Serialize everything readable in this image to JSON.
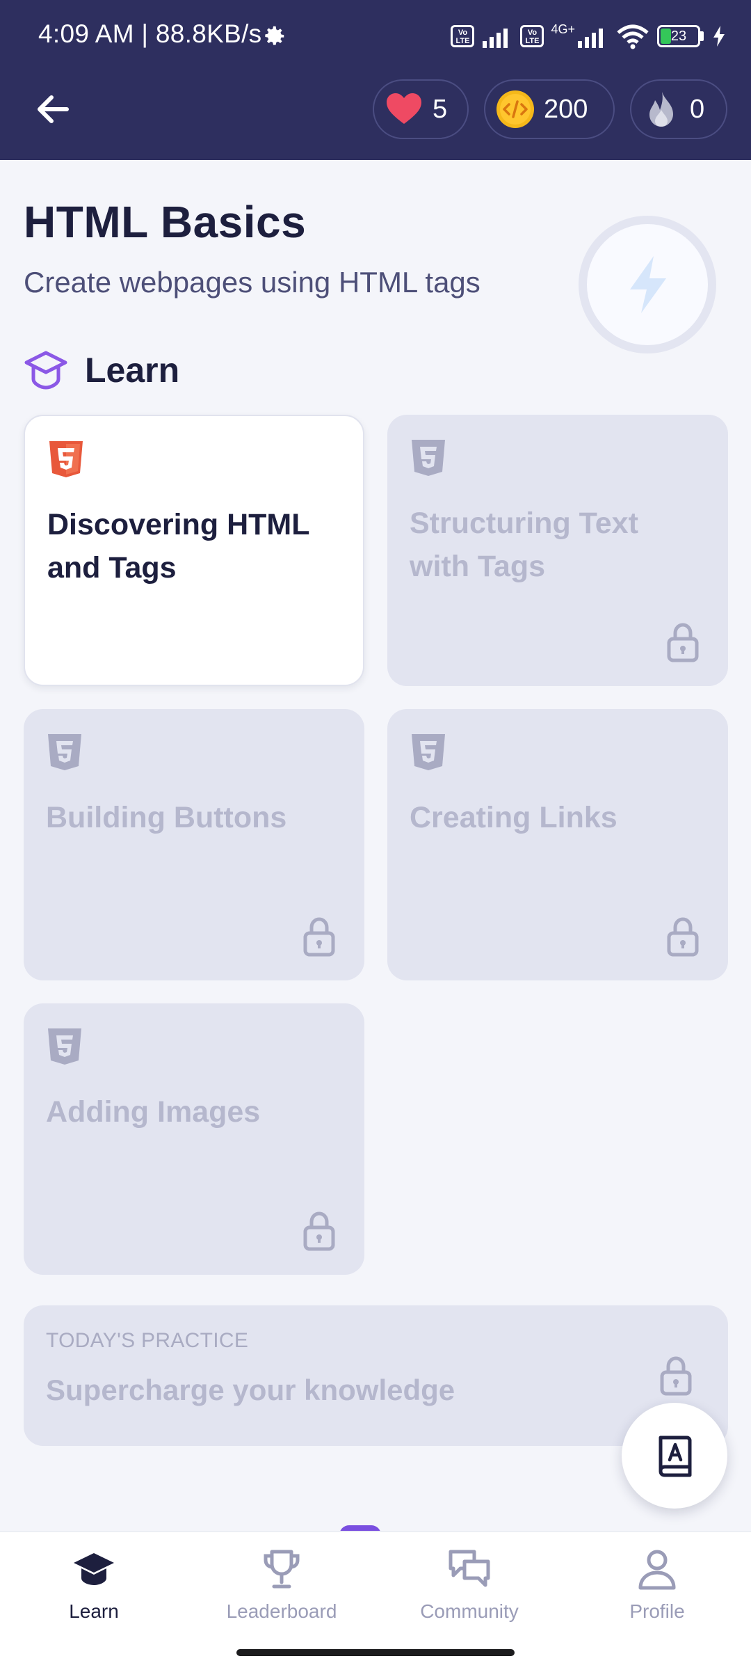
{
  "status_bar": {
    "time": "4:09 AM | 88.8KB/s",
    "volte_1": "Vo LTE",
    "volte_2": "Vo LTE",
    "network_type": "4G+",
    "battery": "23"
  },
  "stats": {
    "hearts": "5",
    "coins": "200",
    "streak": "0"
  },
  "course": {
    "title": "HTML Basics",
    "subtitle": "Create webpages using HTML tags"
  },
  "section": {
    "label": "Learn"
  },
  "lessons": [
    {
      "title": "Discovering HTML and Tags",
      "locked": false,
      "icon": "html5-icon"
    },
    {
      "title": "Structuring Text with Tags",
      "locked": true,
      "icon": "html5-icon"
    },
    {
      "title": "Building Buttons",
      "locked": true,
      "icon": "html5-icon"
    },
    {
      "title": "Creating Links",
      "locked": true,
      "icon": "html5-icon"
    },
    {
      "title": "Adding Images",
      "locked": true,
      "icon": "html5-icon"
    }
  ],
  "practice": {
    "kicker": "TODAY'S PRACTICE",
    "title": "Supercharge your knowledge",
    "locked": true
  },
  "nav": {
    "items": [
      {
        "label": "Learn",
        "icon": "graduation-cap-icon",
        "active": true
      },
      {
        "label": "Leaderboard",
        "icon": "trophy-icon",
        "active": false
      },
      {
        "label": "Community",
        "icon": "chat-bubbles-icon",
        "active": false
      },
      {
        "label": "Profile",
        "icon": "person-icon",
        "active": false
      }
    ]
  },
  "colors": {
    "header_bg": "#2e2f5f",
    "page_bg": "#f4f5fa",
    "html5_orange": "#e8583b",
    "accent_purple": "#7a4fe0",
    "locked_card": "#e2e4f0"
  }
}
